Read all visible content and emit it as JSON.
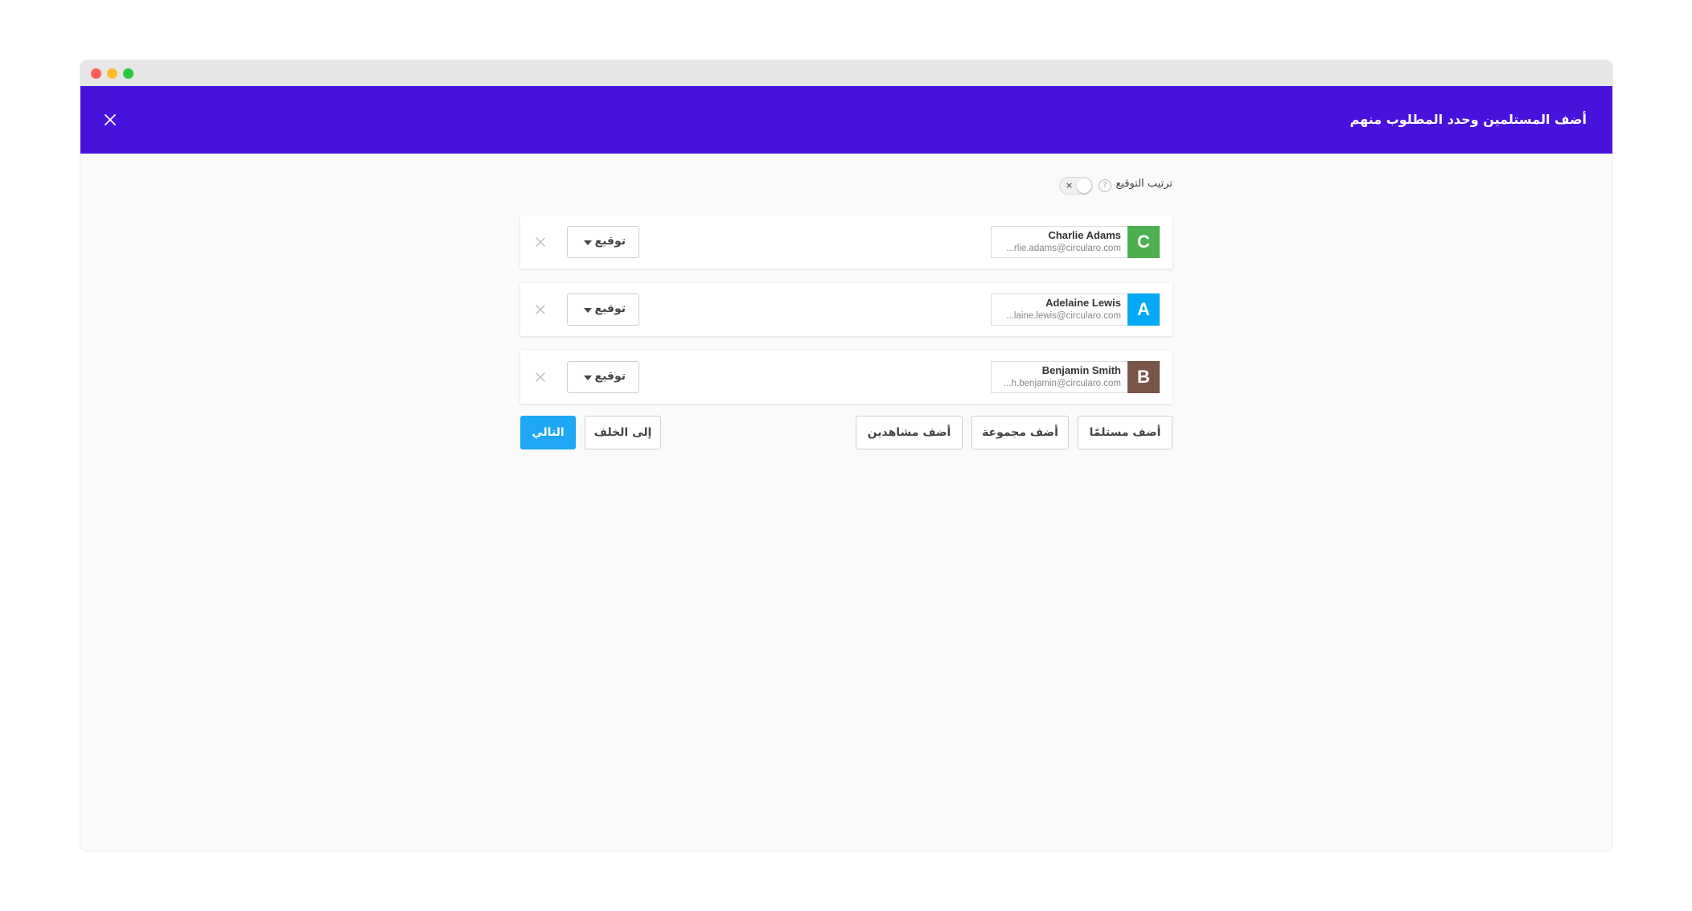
{
  "header": {
    "title": "أضف المستلمين وحدد المطلوب منهم"
  },
  "signing_order": {
    "label": "ترتيب التوقيع",
    "help": "?",
    "toggle_off_symbol": "×",
    "enabled": false
  },
  "recipients": [
    {
      "initial": "C",
      "name": "Charlie Adams",
      "email": "...rlie.adams@circularo.com",
      "role": "توقيع",
      "avatar_color": "#4caf50"
    },
    {
      "initial": "A",
      "name": "Adelaine Lewis",
      "email": "...laine.lewis@circularo.com",
      "role": "توقيع",
      "avatar_color": "#03a9f4"
    },
    {
      "initial": "B",
      "name": "Benjamin Smith",
      "email": "...h.benjamin@circularo.com",
      "role": "توقيع",
      "avatar_color": "#795548"
    }
  ],
  "actions": {
    "add_recipient": "أضف مستلمًا",
    "add_group": "أضف مجموعة",
    "add_viewers": "أضف مشاهدين",
    "back": "إلى الخلف",
    "next": "التالي"
  },
  "colors": {
    "header_bg": "#4712dc",
    "primary": "#1ea7f5"
  }
}
